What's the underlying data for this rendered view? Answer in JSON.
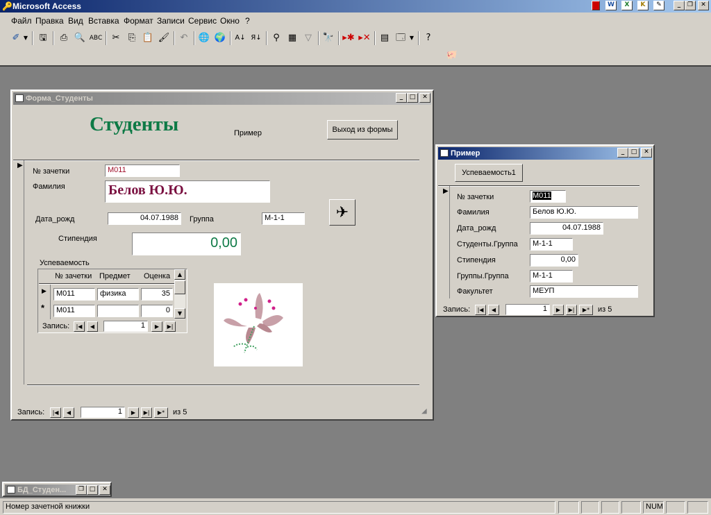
{
  "app_title": "Microsoft Access",
  "menu": [
    "Файл",
    "Правка",
    "Вид",
    "Вставка",
    "Формат",
    "Записи",
    "Сервис",
    "Окно",
    "?"
  ],
  "form_main": {
    "title": "Форма_Студенты",
    "heading": "Студенты",
    "subform_link_label": "Пример",
    "exit_button": "Выход из формы",
    "labels": {
      "zachetka": "№ зачетки",
      "familiya": "Фамилия",
      "data_rozhd": "Дата_рожд",
      "gruppa": "Группа",
      "stipendiya": "Стипендия",
      "uspevaemost": "Успеваемость"
    },
    "values": {
      "zachetka": "М011",
      "familiya": "Белов Ю.Ю.",
      "data_rozhd": "04.07.1988",
      "gruppa": "М-1-1",
      "stipendiya": "0,00"
    },
    "subform": {
      "headers": [
        "№ зачетки",
        "Предмет",
        "Оценка"
      ],
      "rows": [
        {
          "zachetka": "М011",
          "predmet": "физика",
          "ocenka": "35"
        },
        {
          "zachetka": "М011",
          "predmet": "",
          "ocenka": "0"
        }
      ],
      "nav_label": "Запись:",
      "nav_record": "1"
    },
    "nav": {
      "label": "Запись:",
      "record": "1",
      "of_text": "из 5"
    }
  },
  "form_primer": {
    "title": "Пример",
    "button": "Успеваемость1",
    "fields": [
      {
        "label": "№ зачетки",
        "value": "М011"
      },
      {
        "label": "Фамилия",
        "value": "Белов Ю.Ю."
      },
      {
        "label": "Дата_рожд",
        "value": "04.07.1988"
      },
      {
        "label": "Студенты.Группа",
        "value": "М-1-1"
      },
      {
        "label": "Стипендия",
        "value": "0,00"
      },
      {
        "label": "Группы.Группа",
        "value": "М-1-1"
      },
      {
        "label": "Факультет",
        "value": "МЕУП"
      }
    ],
    "nav": {
      "label": "Запись:",
      "record": "1",
      "of_text": "из 5"
    }
  },
  "minimized_db": "БД_Студен...",
  "status": {
    "text": "Номер зачетной книжки",
    "num": "NUM"
  },
  "colors": {
    "heading": "#0e7a46",
    "name": "#7a1040",
    "stip": "#0e7a46"
  }
}
